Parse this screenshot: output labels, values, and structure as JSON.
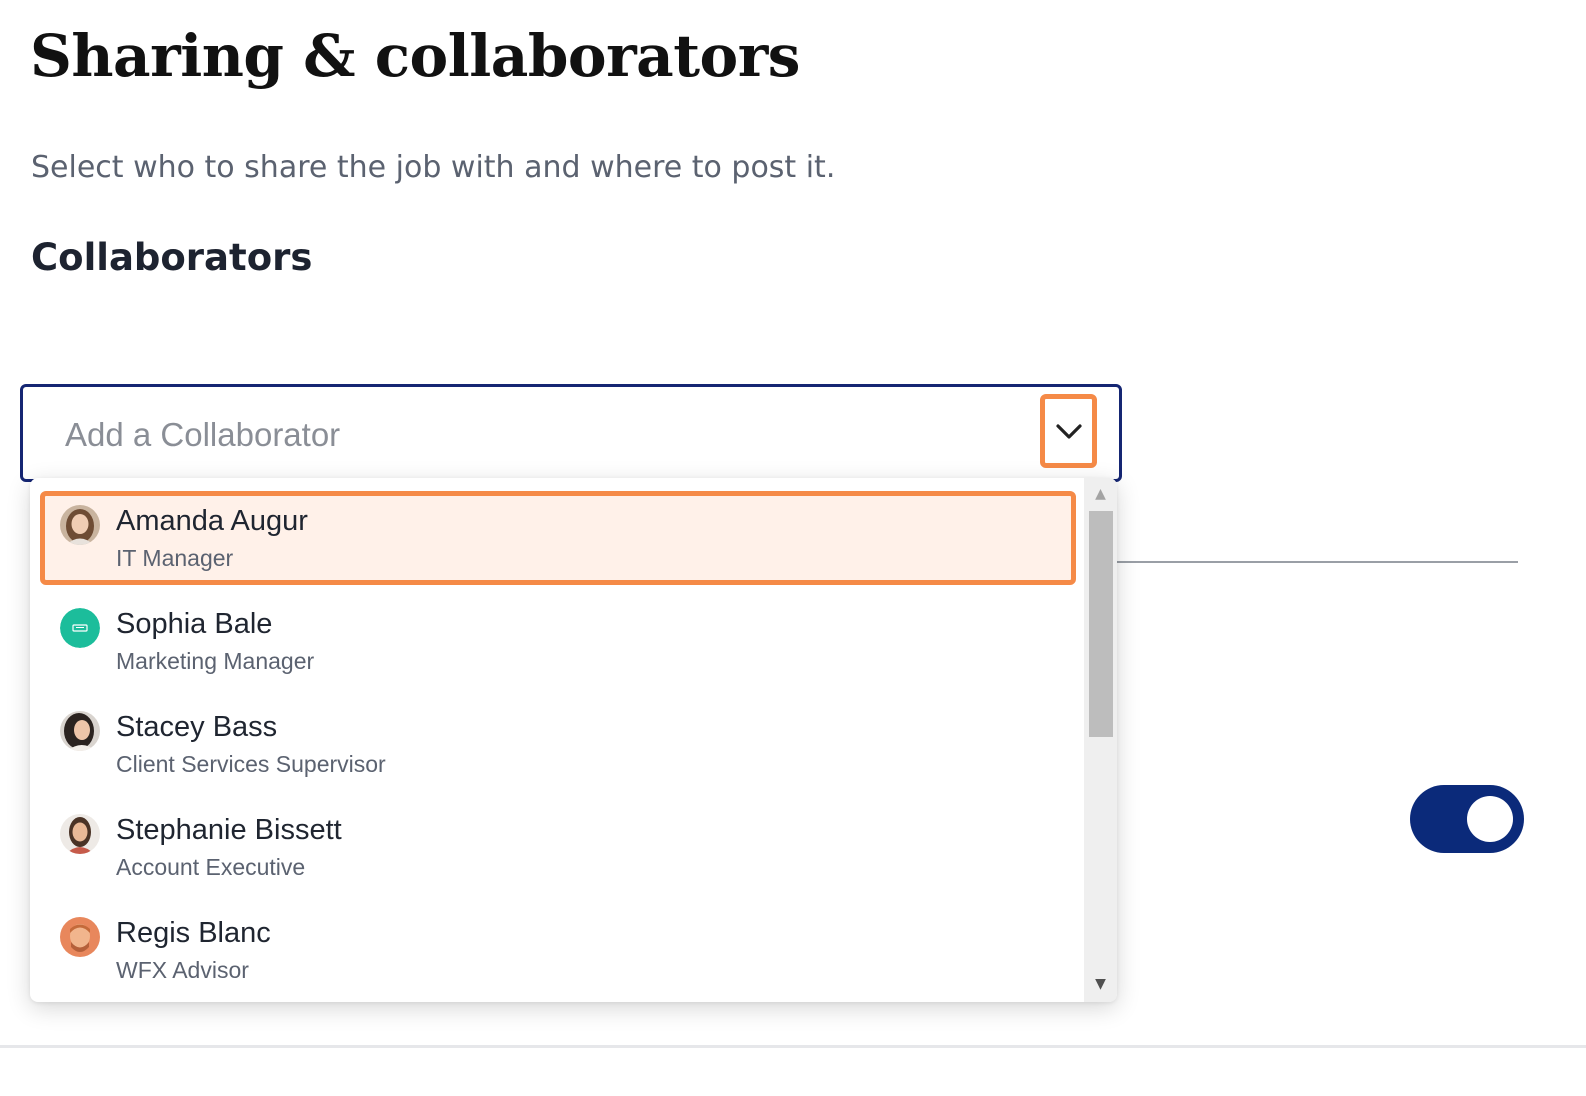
{
  "page": {
    "title": "Sharing & collaborators",
    "subtitle": "Select who to share the job with and where to post it.",
    "section_title": "Collaborators"
  },
  "collaborator_select": {
    "placeholder": "Add a Collaborator",
    "icon": "chevron-down-icon",
    "expanded": true
  },
  "options": [
    {
      "name": "Amanda Augur",
      "role": "IT Manager",
      "avatar": "photo",
      "highlighted": true
    },
    {
      "name": "Sophia Bale",
      "role": "Marketing Manager",
      "avatar": "teal-initials-badge",
      "highlighted": false
    },
    {
      "name": "Stacey Bass",
      "role": "Client Services Supervisor",
      "avatar": "photo",
      "highlighted": false
    },
    {
      "name": "Stephanie Bissett",
      "role": "Account Executive",
      "avatar": "photo",
      "highlighted": false
    },
    {
      "name": "Regis Blanc",
      "role": "WFX Advisor",
      "avatar": "photo",
      "highlighted": false
    }
  ],
  "toggle": {
    "on": true
  },
  "colors": {
    "highlight_border": "#f58a47",
    "highlight_fill": "#fff1e9",
    "field_border": "#152673",
    "toggle_on": "#0b2a7a",
    "teal_avatar": "#1cbd9b"
  }
}
